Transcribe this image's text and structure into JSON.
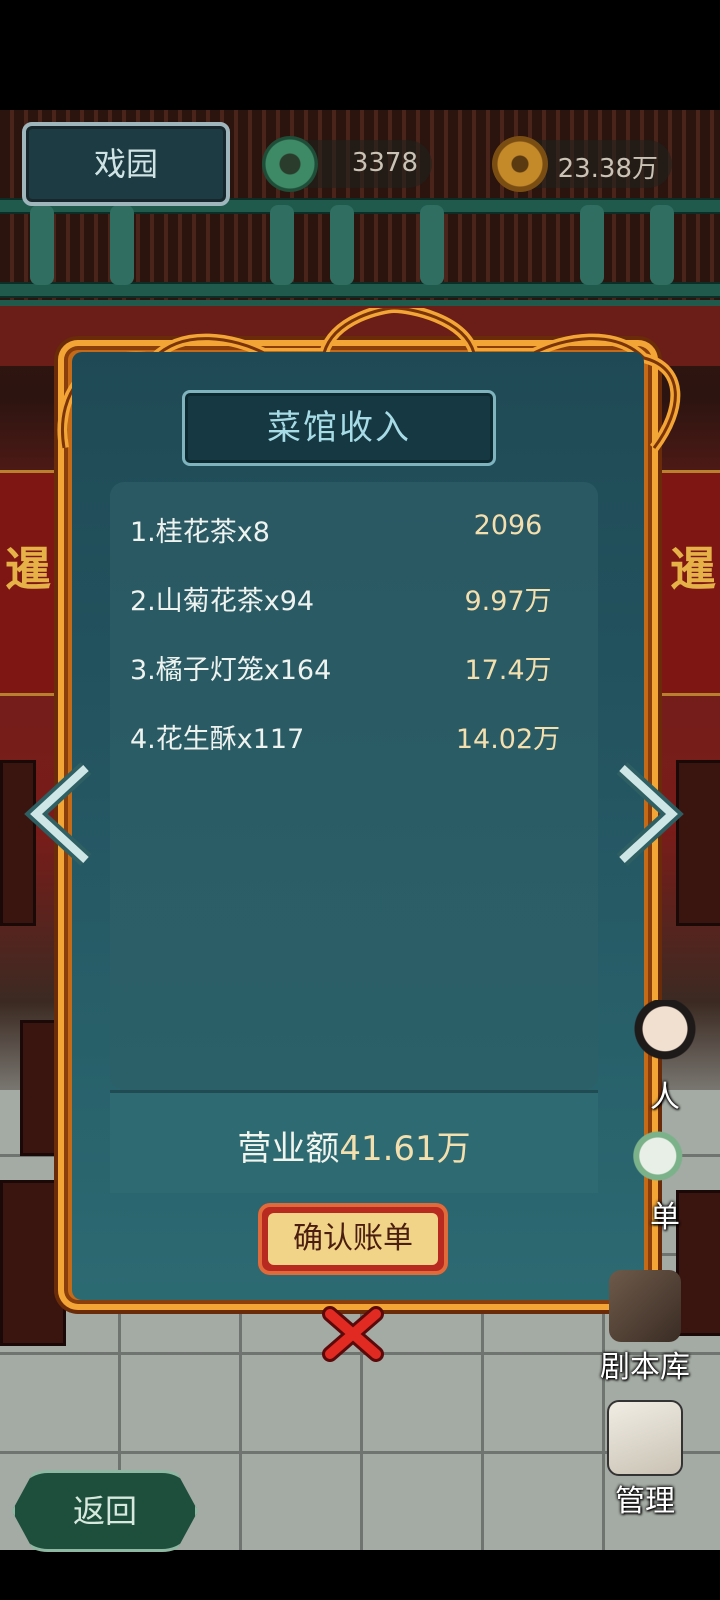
{
  "top_bar": {
    "venue_label": "戏园",
    "jade_value": "3378",
    "coin_value": "23.38万"
  },
  "panel": {
    "title": "菜馆收入",
    "rows": [
      {
        "name": "1.桂花茶x8",
        "amount": "2096"
      },
      {
        "name": "2.山菊花茶x94",
        "amount": "9.97万"
      },
      {
        "name": "3.橘子灯笼x164",
        "amount": "17.4万"
      },
      {
        "name": "4.花生酥x117",
        "amount": "14.02万"
      }
    ],
    "total_label": "营业额",
    "total_value": "41.61万",
    "confirm_label": "确认账单"
  },
  "side_menu": {
    "item1_label": "人",
    "item2_label": "单",
    "item3_label": "剧本库",
    "item4_label": "管理"
  },
  "bottom": {
    "back_label": "返回"
  },
  "banner_char": "暹",
  "colors": {
    "panel_bg": "#235460",
    "frame_gold": "#f3a636",
    "amount_text": "#f4dfae",
    "confirm_red": "#b8291f"
  }
}
